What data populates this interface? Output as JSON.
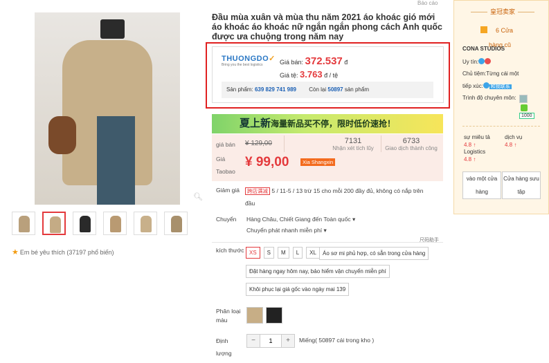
{
  "report_label": "Báo cáo",
  "product": {
    "title": "Đầu mùa xuân và mùa thu năm 2021 áo khoác gió mới áo khoác áo khoác nữ ngắn ngắn phong cách Anh quốc được ưa chuộng trong năm nay",
    "favorite": "Em bé yêu thích (37197 phổ biến)"
  },
  "pricebox": {
    "logo_text": "THUONGDO",
    "logo_sub": "Bring you the best logistics",
    "price_label": "Giá bán:",
    "price_value": "372.537",
    "price_unit": "đ",
    "rate_label": "Giá tệ:",
    "rate_value": "3.763",
    "rate_unit": "đ / tệ",
    "product_label": "Sản phẩm:",
    "product_code": "639 829 741 989",
    "remaining_label": "Còn lại",
    "remaining_value": "50897",
    "remaining_unit": "sản phẩm"
  },
  "banner": {
    "big": "夏上新",
    "text": "海量新品买不停，限时低价速抢！"
  },
  "pricing": {
    "orig_label": "giá bán",
    "orig_value": "¥ 129,00",
    "taobao_label1": "Giá",
    "taobao_label2": "Taobao",
    "now_value": "¥ 99,00",
    "now_tag": "Xia Shangxin",
    "reviews_value": "7131",
    "reviews_label": "Nhận xét tích lũy",
    "deals_value": "6733",
    "deals_label": "Giao dịch thành công"
  },
  "discount": {
    "label": "Giảm giá",
    "tag": "跨店满减",
    "text": "5 / 11-5 / 13 trừ 15 cho mỗi 200 đầy đủ, không có nắp trên",
    "text2": "đầu"
  },
  "shipping": {
    "label": "Chuyển",
    "from_to": "Hàng Châu, Chiết Giang đến Toàn quốc",
    "method": "Chuyển phát nhanh miễn phí"
  },
  "size_helper": "尺码助手",
  "size": {
    "label": "kích thước",
    "options": [
      "XS",
      "S",
      "M",
      "L",
      "XL"
    ],
    "selected": "XS",
    "note1": "Áo sơ mi phủ hợp, có sẵn trong cửa hàng",
    "note2": "Đặt hàng ngay hôm nay, bảo hiểm vận chuyển miễn phí",
    "note3": "Khôi phục lại giá gốc vào ngày mai 139"
  },
  "color": {
    "label1": "Phân loại",
    "label2": "màu"
  },
  "quantity": {
    "label1": "Định",
    "label2": "lượng",
    "minus": "−",
    "value": "1",
    "plus": "+",
    "stock": "Miếng( 50897 cái trong kho )"
  },
  "shop": {
    "crown_title": "皇冠卖家",
    "store_text": "6 Cửa",
    "store_text2": "hàng cũ",
    "name": "CONA STUDIOS",
    "trust_label": "Uy tín:",
    "owner_label": "Chủ tiệm:",
    "owner_name": "Từng cái một",
    "contact_label": "tiếp xúc:",
    "contact_text": "和我联系",
    "expert_label": "Trình độ chuyên môn:",
    "expert_value": "1000",
    "desc_label": "sự miêu tả",
    "desc_score": "4.8 ↑",
    "service_label": "dịch vụ",
    "service_score": "4.8 ↑",
    "logistics_label": "Logistics",
    "logistics_score": "4.8 ↑",
    "enter_btn1": "vào một cửa",
    "enter_btn2": "hàng",
    "collect_btn1": "Cửa hàng sưu",
    "collect_btn2": "tập"
  },
  "colors": {
    "accent": "#e4393c",
    "highlight_box": "#e02020",
    "shop_panel": "#fff6e6",
    "banner_start": "#7fd36a",
    "banner_end": "#f7e55a"
  }
}
